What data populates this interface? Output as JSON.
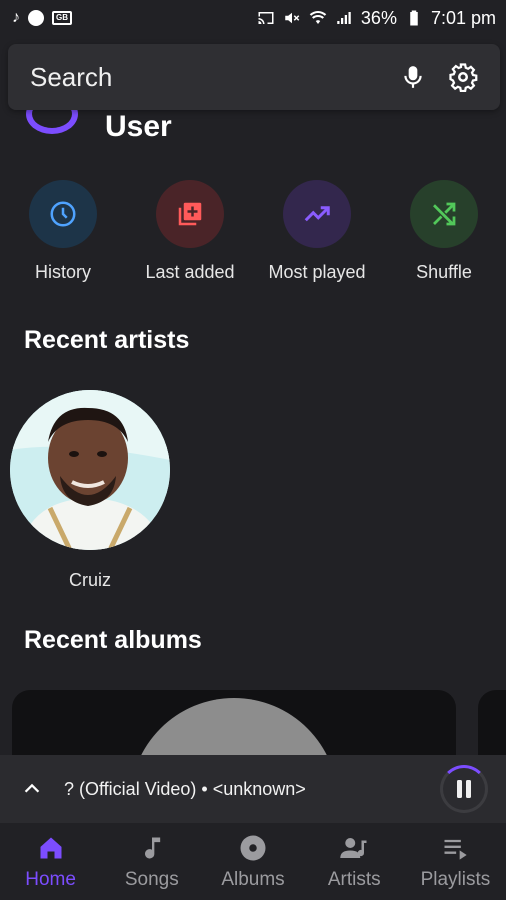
{
  "status_bar": {
    "battery": "36%",
    "time": "7:01 pm",
    "icons": [
      "music-note-icon",
      "strava-icon",
      "gallery-icon",
      "cast-icon",
      "mute-icon",
      "wifi-icon",
      "signal-icon",
      "battery-icon"
    ]
  },
  "search": {
    "placeholder": "Search",
    "mic_icon": "mic-icon",
    "settings_icon": "gear-icon"
  },
  "user": {
    "name": "User"
  },
  "shortcuts": [
    {
      "label": "History",
      "icon": "clock-icon",
      "color": "#4fa3ff",
      "bg": "#1d3448"
    },
    {
      "label": "Last added",
      "icon": "library-add-icon",
      "color": "#ff5a5a",
      "bg": "#4a2428"
    },
    {
      "label": "Most played",
      "icon": "trending-up-icon",
      "color": "#8a5cff",
      "bg": "#33274d"
    },
    {
      "label": "Shuffle",
      "icon": "shuffle-icon",
      "color": "#52c85a",
      "bg": "#27402b"
    }
  ],
  "sections": {
    "recent_artists": "Recent artists",
    "recent_albums": "Recent albums"
  },
  "artists": [
    {
      "name": "Cruiz"
    }
  ],
  "player": {
    "track": "? (Official Video) • <unknown>",
    "expand_icon": "chevron-up-icon",
    "pause_icon": "pause-icon"
  },
  "nav": [
    {
      "label": "Home",
      "icon": "home-icon",
      "active": true
    },
    {
      "label": "Songs",
      "icon": "music-note-icon",
      "active": false
    },
    {
      "label": "Albums",
      "icon": "album-icon",
      "active": false
    },
    {
      "label": "Artists",
      "icon": "artist-icon",
      "active": false
    },
    {
      "label": "Playlists",
      "icon": "playlist-icon",
      "active": false
    }
  ],
  "colors": {
    "accent": "#7c4dff",
    "background": "#212125",
    "surface": "#2f2f33"
  }
}
